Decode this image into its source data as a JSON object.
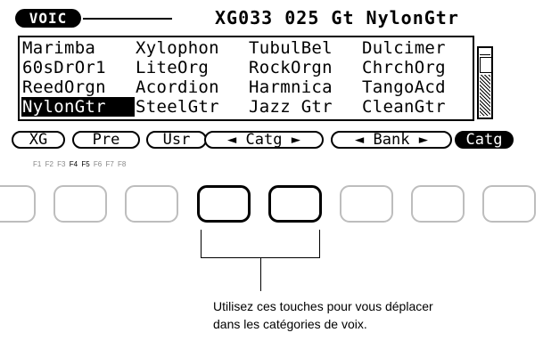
{
  "header": {
    "mode_label": "VOIC",
    "voice_title": "XG033 025 Gt NylonGtr"
  },
  "voice_grid": [
    [
      "Marimba",
      "Xylophon",
      "TubulBel",
      "Dulcimer"
    ],
    [
      "60sDrOr1",
      "LiteOrg",
      "RockOrgn",
      "ChrchOrg"
    ],
    [
      "ReedOrgn",
      "Acordion",
      "Harmnica",
      "TangoAcd"
    ],
    [
      "NylonGtr",
      "SteelGtr",
      "Jazz Gtr",
      "CleanGtr"
    ]
  ],
  "selected_voice": "NylonGtr",
  "softkeys": [
    {
      "label": "XG"
    },
    {
      "label": "Pre"
    },
    {
      "label": "Usr"
    },
    {
      "label": "◄ Catg ►"
    },
    {
      "label": "◄ Bank ►"
    },
    {
      "label": "Catg"
    }
  ],
  "f_labels": [
    "F1",
    "F2",
    "F3",
    "F4",
    "F5",
    "F6",
    "F7",
    "F8"
  ],
  "highlighted_f": [
    "F4",
    "F5"
  ],
  "callout": {
    "text": "Utilisez ces touches pour vous déplacer dans les catégories de voix."
  }
}
